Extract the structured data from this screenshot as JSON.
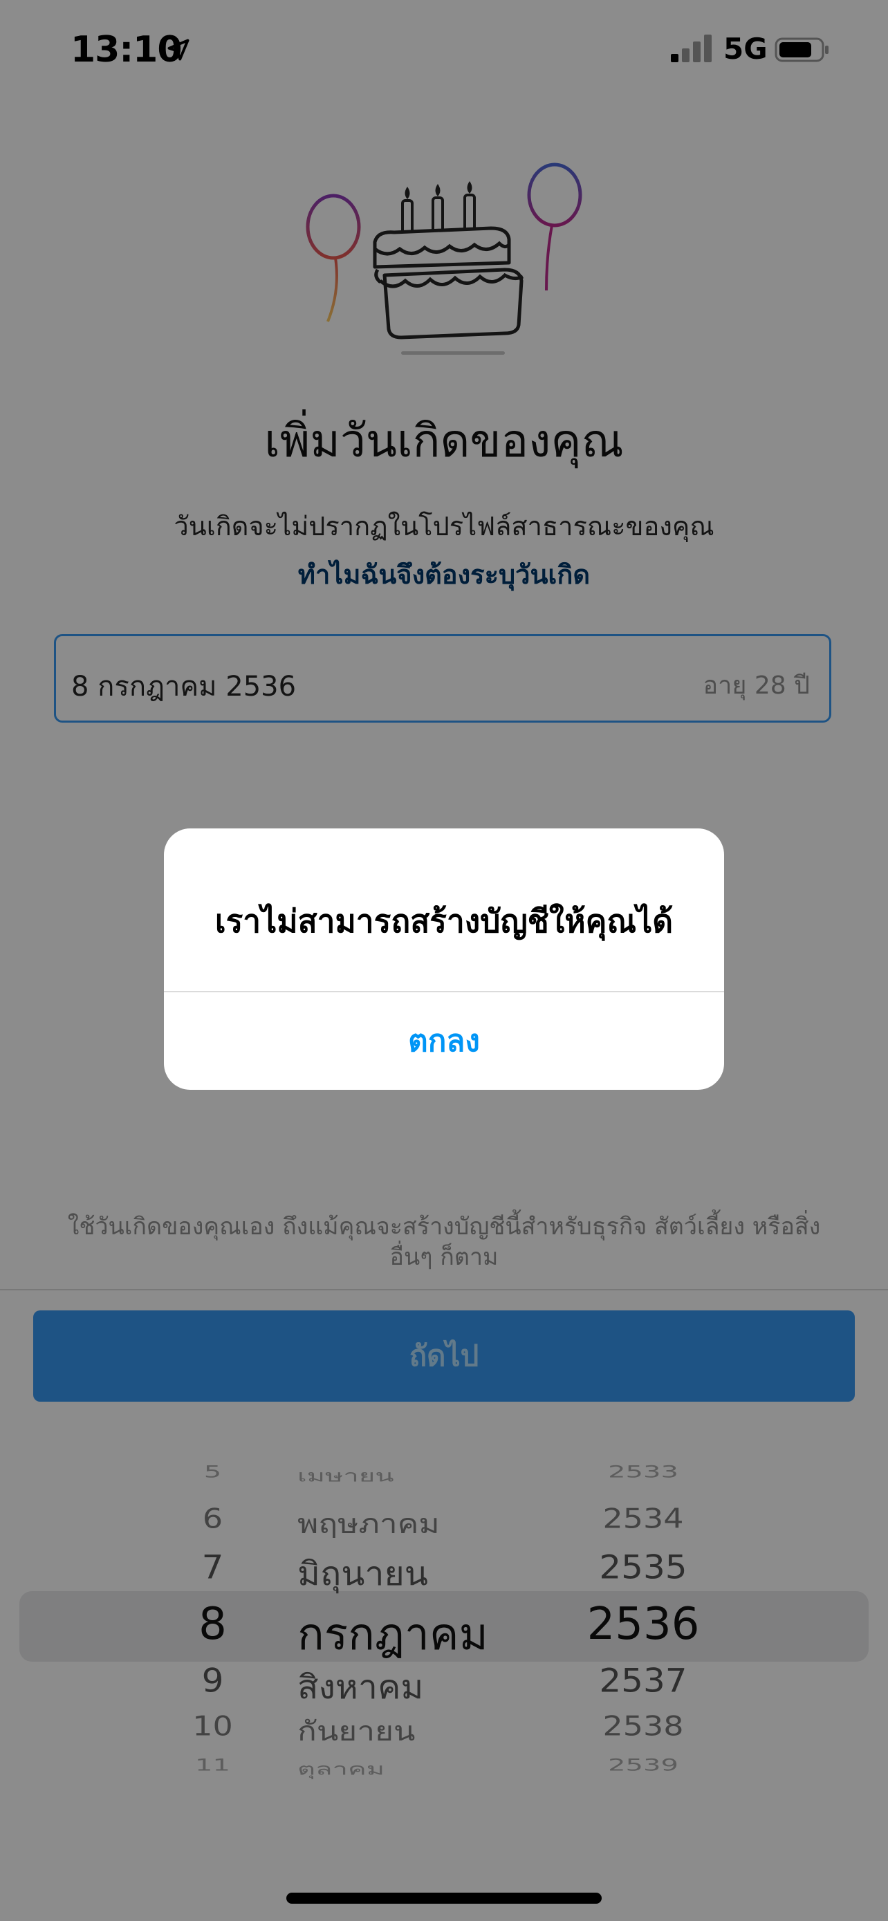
{
  "status_bar": {
    "time": "13:10",
    "network": "5G",
    "icons": [
      "location-arrow-icon",
      "signal-icon",
      "battery-icon"
    ]
  },
  "main": {
    "title": "เพิ่มวันเกิดของคุณ",
    "subtitle": "วันเกิดจะไม่ปรากฏในโปรไฟล์สาธารณะของคุณ",
    "why_link": "ทำไมฉันจึงต้องระบุวันเกิด",
    "date_value": "8 กรกฎาคม 2536",
    "age_label": "อายุ 28 ปี",
    "note_line1": "ใช้วันเกิดของคุณเอง ถึงแม้คุณจะสร้างบัญชีนี้สำหรับธุรกิจ สัตว์เลี้ยง หรือสิ่ง",
    "note_line2": "อื่นๆ ก็ตาม",
    "next_button": "ถัดไป"
  },
  "picker": {
    "rows": [
      {
        "day": "5",
        "month": "เมษายน",
        "year": "2533"
      },
      {
        "day": "6",
        "month": "พฤษภาคม",
        "year": "2534"
      },
      {
        "day": "7",
        "month": "มิถุนายน",
        "year": "2535"
      },
      {
        "day": "8",
        "month": "กรกฎาคม",
        "year": "2536"
      },
      {
        "day": "9",
        "month": "สิงหาคม",
        "year": "2537"
      },
      {
        "day": "10",
        "month": "กันยายน",
        "year": "2538"
      },
      {
        "day": "11",
        "month": "ตุลาคม",
        "year": "2539"
      }
    ],
    "selected_index": 3
  },
  "alert": {
    "title": "เราไม่สามารถสร้างบัญชีให้คุณได้",
    "ok_button": "ตกลง"
  },
  "colors": {
    "accent_blue": "#3897f0",
    "link_blue": "#00376b",
    "alert_button": "#0095f6",
    "overlay": "rgba(0,0,0,0.45)"
  }
}
